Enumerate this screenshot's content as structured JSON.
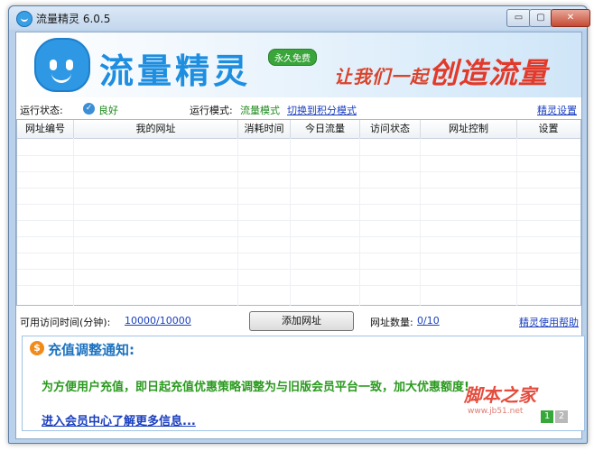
{
  "window": {
    "title": "流量精灵 6.0.5",
    "min_label": "▭",
    "max_label": "▢",
    "close_label": "✕"
  },
  "banner": {
    "logo_text": "流量精灵",
    "badge": "永久免费",
    "slogan_small": "让我们一起",
    "slogan_big": "创造流量"
  },
  "status": {
    "run_status_label": "运行状态:",
    "run_status_value": "良好",
    "mode_label": "运行模式:",
    "mode_value": "流量模式",
    "switch_link": "切换到积分模式",
    "settings_link": "精灵设置"
  },
  "table": {
    "columns": [
      "网址编号",
      "我的网址",
      "消耗时间",
      "今日流量",
      "访问状态",
      "网址控制",
      "设置"
    ],
    "rows": []
  },
  "bottom": {
    "time_label": "可用访问时间(分钟):",
    "time_value": "10000/10000",
    "add_button": "添加网址",
    "count_label": "网址数量:",
    "count_value": "0/10",
    "help_link": "精灵使用帮助"
  },
  "notice": {
    "icon": "$",
    "title": "充值调整通知:",
    "body": "为方便用户充值，即日起充值优惠策略调整为与旧版会员平台一致，加大优惠额度!",
    "link": "进入会员中心了解更多信息...",
    "pages": [
      "1",
      "2"
    ]
  },
  "watermark": {
    "text": "脚本之家",
    "url": "www.jb51.net"
  }
}
